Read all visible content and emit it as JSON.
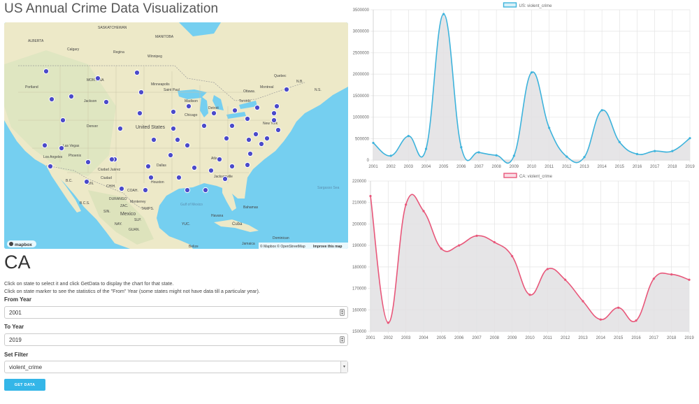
{
  "page": {
    "title": "US Annual Crime Data Visualization"
  },
  "map": {
    "attribution": "© Mapbox © OpenStreetMap",
    "improve_link": "Improve this map",
    "logo": "mapbox",
    "labels": [
      "SASKATCHEWAN",
      "MANITOBA",
      "ALBERTA",
      "Calgary",
      "Regina",
      "Winnipeg",
      "Portland",
      "Jackson",
      "MONTANA",
      "Minneapolis",
      "Saint Paul",
      "Madison",
      "Chicago",
      "Detroit",
      "Toronto",
      "Ottawa",
      "Montreal",
      "Quebec",
      "N.B.",
      "N.S.",
      "New York",
      "United States",
      "Denver",
      "Las Vegas",
      "Los Angeles",
      "Phoenix",
      "Ciudad Juárez",
      "Dallas",
      "Houston",
      "Atlanta",
      "Jacksonville",
      "Mexico",
      "Monterrey",
      "Gulf of Mexico",
      "Havana",
      "Cuba",
      "Bahamas",
      "Dominican",
      "Jamaica",
      "Belize",
      "SON.",
      "CHIH.",
      "COAH.",
      "B.C.S.",
      "SIN.",
      "NAY.",
      "SLP.",
      "GUAN.",
      "YUC.",
      "Sargasso Sea",
      "B.C.",
      "Ciudad",
      "TAMPS.",
      "DURANGO",
      "ZAC."
    ]
  },
  "state": {
    "code": "CA"
  },
  "info": {
    "line1": "Click on state to select it and click GetData to display the chart for that state.",
    "line2": "Click on state marker to see the statistics of the \"From\" Year (some states might not have data till a particular year)."
  },
  "form": {
    "from_label": "From Year",
    "from_value": "2001",
    "to_label": "To Year",
    "to_value": "2019",
    "filter_label": "Set Filter",
    "filter_value": "violent_crime",
    "submit_label": "GET DATA"
  },
  "colors": {
    "us": "#3db3dc",
    "ca": "#e8577a",
    "accent": "#34b6e8",
    "fill": "#e2e0e3"
  },
  "chart_data": [
    {
      "type": "line",
      "legend": "US: violent_crime",
      "x": [
        2001,
        2002,
        2003,
        2004,
        2005,
        2006,
        2007,
        2008,
        2009,
        2010,
        2011,
        2012,
        2013,
        2014,
        2015,
        2016,
        2017,
        2018,
        2019
      ],
      "values": [
        400000,
        100000,
        560000,
        260000,
        3400000,
        300000,
        180000,
        110000,
        100000,
        2040000,
        750000,
        80000,
        70000,
        1160000,
        420000,
        140000,
        210000,
        210000,
        510000
      ],
      "ylim": [
        0,
        3500000
      ],
      "yticks": [
        "0",
        "500000",
        "1000000",
        "1500000",
        "2000000",
        "2500000",
        "3000000",
        "3500000"
      ],
      "grid": true
    },
    {
      "type": "line",
      "legend": "CA: violent_crime",
      "x": [
        2001,
        2002,
        2003,
        2004,
        2005,
        2006,
        2007,
        2008,
        2009,
        2010,
        2011,
        2012,
        2013,
        2014,
        2015,
        2016,
        2017,
        2018,
        2019
      ],
      "values": [
        213000,
        154000,
        209000,
        206000,
        188500,
        190000,
        194500,
        191500,
        185000,
        167000,
        179000,
        174000,
        164000,
        155500,
        161000,
        155000,
        174500,
        176500,
        174000
      ],
      "ylim": [
        150000,
        220000
      ],
      "yticks": [
        "150000",
        "160000",
        "170000",
        "180000",
        "190000",
        "200000",
        "210000",
        "220000"
      ],
      "grid": true
    }
  ]
}
